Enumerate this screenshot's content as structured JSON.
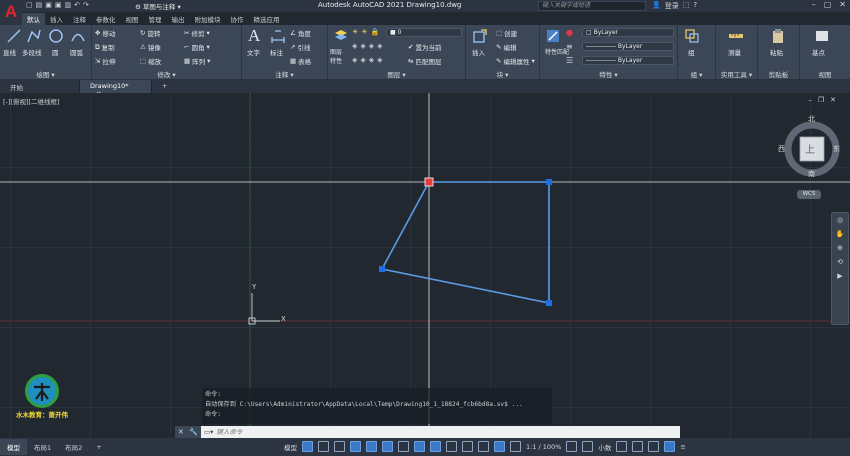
{
  "title_bar": {
    "app_title": "Autodesk AutoCAD 2021    Drawing10.dwg",
    "workspace": "草图与注释",
    "search_placeholder": "键入关键字或短语",
    "login_label": "登录"
  },
  "ribbon_tabs": [
    "默认",
    "插入",
    "注释",
    "参数化",
    "视图",
    "管理",
    "输出",
    "附加模块",
    "协作",
    "精选应用"
  ],
  "ribbon": {
    "draw": {
      "label": "绘图",
      "line": "直线",
      "polyline": "多段线",
      "circle": "圆",
      "arc": "圆弧"
    },
    "modify": {
      "label": "修改",
      "move": "移动",
      "rotate": "旋转",
      "trim": "修剪",
      "copy": "复制",
      "mirror": "镜像",
      "fillet": "圆角",
      "stretch": "拉伸",
      "scale": "缩放",
      "array": "阵列"
    },
    "annotation": {
      "label": "注释",
      "text": "文字",
      "dimension": "标注",
      "leader": "引线",
      "table": "表格",
      "angular": "角度"
    },
    "layers": {
      "label": "图层",
      "layer_props": "图层特性",
      "current_layer": "0",
      "make_current": "置为当前",
      "match_layer": "匹配图层"
    },
    "block": {
      "label": "块",
      "insert": "插入",
      "create": "创建",
      "edit": "编辑",
      "edit_attr": "编辑属性"
    },
    "properties": {
      "label": "特性",
      "match": "特性匹配",
      "color": "ByLayer",
      "linetype": "ByLayer",
      "lineweight": "ByLayer"
    },
    "groups": {
      "label": "组",
      "group": "组"
    },
    "utilities": {
      "label": "实用工具",
      "measure": "测量"
    },
    "clipboard": {
      "label": "剪贴板",
      "paste": "粘贴"
    },
    "view": {
      "label": "视图",
      "base": "基点"
    }
  },
  "file_tabs": [
    "开始",
    "Drawing10*"
  ],
  "viewport": {
    "label": "[-][俯视][二维线框]",
    "ucs_x": "X",
    "ucs_y": "Y",
    "wcs_label": "WCS",
    "compass": {
      "north": "北",
      "south": "南",
      "east": "东",
      "west": "西",
      "top": "上"
    }
  },
  "command": {
    "history": [
      "命令:",
      "自动保存到 C:\\Users\\Administrator\\AppData\\Local\\Temp\\Drawing10_1_18824_fcb6bd8a.sv$ ...",
      "命令:"
    ],
    "placeholder": "键入命令"
  },
  "layout_tabs": [
    "模型",
    "布局1",
    "布局2"
  ],
  "status": {
    "model": "模型",
    "scale": "1:1 / 100%",
    "units": "小数"
  },
  "watermark": {
    "text": "水木教育：萧开伟"
  },
  "colors": {
    "accent": "#3a78c8",
    "polyline": "#5b9be6",
    "grip": "#1e6ee8",
    "grip_hot": "#e23b3b",
    "crosshair": "#e6e6e6"
  }
}
